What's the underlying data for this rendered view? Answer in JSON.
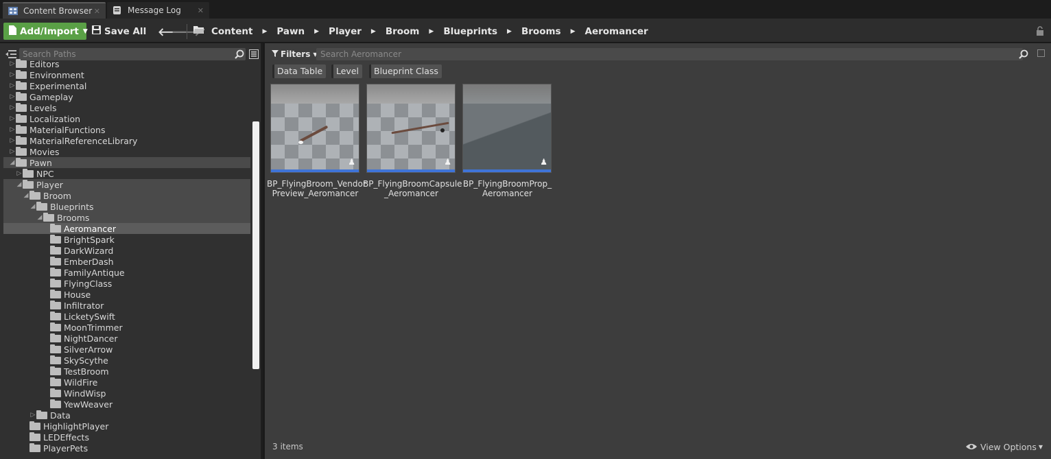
{
  "tabs": [
    {
      "label": "Content Browser",
      "active": true
    },
    {
      "label": "Message Log",
      "active": false
    }
  ],
  "toolbar": {
    "add_import_label": "Add/Import",
    "save_all_label": "Save All",
    "breadcrumbs": [
      "Content",
      "Pawn",
      "Player",
      "Broom",
      "Blueprints",
      "Brooms",
      "Aeromancer"
    ]
  },
  "sources": {
    "search_placeholder": "Search Paths",
    "tree": [
      {
        "label": "Editors",
        "depth": 0,
        "expander": "collapsed"
      },
      {
        "label": "Environment",
        "depth": 0,
        "expander": "collapsed"
      },
      {
        "label": "Experimental",
        "depth": 0,
        "expander": "collapsed"
      },
      {
        "label": "Gameplay",
        "depth": 0,
        "expander": "collapsed"
      },
      {
        "label": "Levels",
        "depth": 0,
        "expander": "collapsed"
      },
      {
        "label": "Localization",
        "depth": 0,
        "expander": "collapsed"
      },
      {
        "label": "MaterialFunctions",
        "depth": 0,
        "expander": "collapsed"
      },
      {
        "label": "MaterialReferenceLibrary",
        "depth": 0,
        "expander": "collapsed"
      },
      {
        "label": "Movies",
        "depth": 0,
        "expander": "collapsed"
      },
      {
        "label": "Pawn",
        "depth": 0,
        "expander": "expanded",
        "state": "highlight"
      },
      {
        "label": "NPC",
        "depth": 1,
        "expander": "collapsed"
      },
      {
        "label": "Player",
        "depth": 1,
        "expander": "expanded",
        "state": "highlight"
      },
      {
        "label": "Broom",
        "depth": 2,
        "expander": "expanded",
        "state": "highlight"
      },
      {
        "label": "Blueprints",
        "depth": 3,
        "expander": "expanded",
        "state": "highlight"
      },
      {
        "label": "Brooms",
        "depth": 4,
        "expander": "expanded",
        "state": "highlight"
      },
      {
        "label": "Aeromancer",
        "depth": 5,
        "expander": "none",
        "state": "selected"
      },
      {
        "label": "BrightSpark",
        "depth": 5,
        "expander": "none"
      },
      {
        "label": "DarkWizard",
        "depth": 5,
        "expander": "none"
      },
      {
        "label": "EmberDash",
        "depth": 5,
        "expander": "none"
      },
      {
        "label": "FamilyAntique",
        "depth": 5,
        "expander": "none"
      },
      {
        "label": "FlyingClass",
        "depth": 5,
        "expander": "none"
      },
      {
        "label": "House",
        "depth": 5,
        "expander": "none"
      },
      {
        "label": "Infiltrator",
        "depth": 5,
        "expander": "none"
      },
      {
        "label": "LicketySwift",
        "depth": 5,
        "expander": "none"
      },
      {
        "label": "MoonTrimmer",
        "depth": 5,
        "expander": "none"
      },
      {
        "label": "NightDancer",
        "depth": 5,
        "expander": "none"
      },
      {
        "label": "SilverArrow",
        "depth": 5,
        "expander": "none"
      },
      {
        "label": "SkyScythe",
        "depth": 5,
        "expander": "none"
      },
      {
        "label": "TestBroom",
        "depth": 5,
        "expander": "none"
      },
      {
        "label": "WildFire",
        "depth": 5,
        "expander": "none"
      },
      {
        "label": "WindWisp",
        "depth": 5,
        "expander": "none"
      },
      {
        "label": "YewWeaver",
        "depth": 5,
        "expander": "none"
      },
      {
        "label": "Data",
        "depth": 3,
        "expander": "collapsed"
      },
      {
        "label": "HighlightPlayer",
        "depth": 2,
        "expander": "none"
      },
      {
        "label": "LEDEffects",
        "depth": 2,
        "expander": "none"
      },
      {
        "label": "PlayerPets",
        "depth": 2,
        "expander": "none"
      }
    ]
  },
  "assets": {
    "filters_label": "Filters",
    "search_placeholder": "Search Aeromancer",
    "filter_chips": [
      "Data Table",
      "Level",
      "Blueprint Class"
    ],
    "items": [
      {
        "line1": "BP_FlyingBroom_Vendor",
        "line2": "Preview_Aeromancer",
        "thumb": "checker"
      },
      {
        "line1": "BP_FlyingBroomCapsule",
        "line2": "_Aeromancer",
        "thumb": "checker"
      },
      {
        "line1": "BP_FlyingBroomProp_",
        "line2": "Aeromancer",
        "thumb": "dark"
      }
    ],
    "item_count": "3 items",
    "view_options_label": "View Options"
  },
  "colors": {
    "accent_green": "#5aa046",
    "asset_bar_blue": "#3f74d8",
    "selection": "#5c5c5c"
  }
}
